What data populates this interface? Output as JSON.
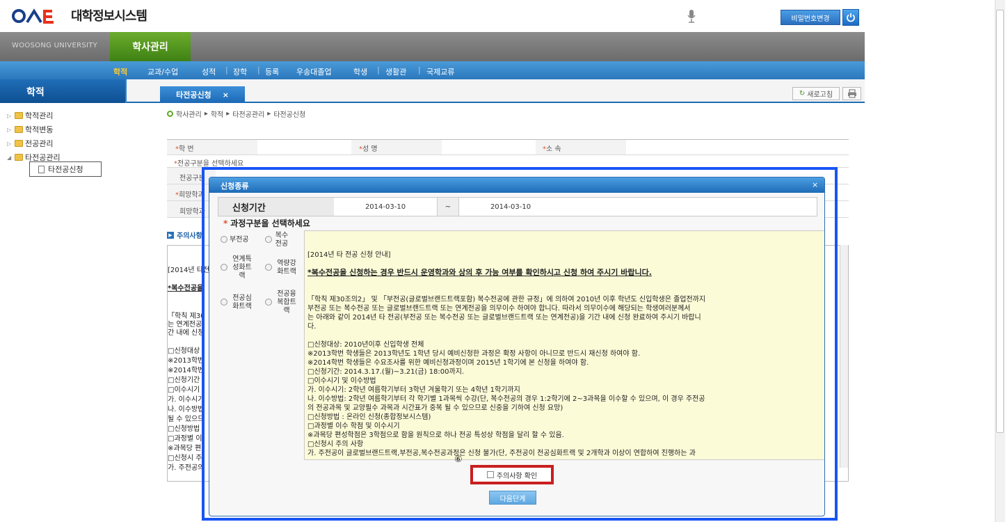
{
  "header": {
    "system_title": "대학정보시스템",
    "password_button": "비밀번호변경"
  },
  "topbar": {
    "university": "WOOSONG UNIVERSITY",
    "main_tab": "학사관리"
  },
  "menu": {
    "items": [
      "학적",
      "교과/수업",
      "성적",
      "장학",
      "등록",
      "우송대졸업",
      "학생",
      "생활관",
      "국제교류"
    ],
    "active_index": 0
  },
  "sidebar": {
    "title": "학적",
    "tree": [
      {
        "label": "학적관리"
      },
      {
        "label": "학적변동"
      },
      {
        "label": "전공관리"
      },
      {
        "label": "타전공관리"
      }
    ],
    "selected_leaf": "타전공신청"
  },
  "content": {
    "tab_label": "타전공신청",
    "tab_close": "×",
    "refresh_label": "새로고침",
    "breadcrumb": [
      "학사관리",
      "학적",
      "타전공관리",
      "타전공신청"
    ],
    "form": {
      "student_no_label": "학 번",
      "name_label": "성 명",
      "affiliation_label": "소 속",
      "major_type_prompt": "전공구분을 선택하세요",
      "major_type_label": "전공구분",
      "desired_label": "희망학과",
      "desired2_label": "희망학과"
    },
    "notice_header": "주의사항",
    "under_notice_lines": [
      "[2014년 타전공",
      "*복수전공을",
      "「학칙 제30",
      "는 연계전공",
      "간 내에 신청",
      "□신청대상",
      "※2013학번",
      "※2014학번",
      "□신청기간",
      "□이수시기",
      "가. 이수시기",
      "나. 이수방법",
      "될 수 있으므",
      "□신청방법",
      "□과정별 이",
      "※과목당 편",
      "□신청시 주",
      "가. 주전공의"
    ]
  },
  "modal": {
    "title": "신청종류",
    "close": "×",
    "period_label": "신청기간",
    "start_date": "2014-03-10",
    "tilde": "~",
    "end_date": "2014-03-10",
    "section_title": "과정구분을 선택하세요",
    "options": [
      "부전공",
      "복수전공",
      "연계특성화트랙",
      "역량강화트랙",
      "전공심화트랙",
      "전공융복합트랙"
    ],
    "notice_lines": [
      "[2014년 타 전공 신청 안내]",
      "*복수전공을 신청하는 경우 반드시 운영학과와 상의 후 가능 여부를 확인하시고 신청 하여 주시기 바랍니다.",
      "「학칙 제30조의2」 및 「부전공(글로벌브랜드트랙포함) 복수전공에 관한 규정」에 의하여 2010년 이후 학년도 신입학생은 졸업전까지",
      "부전공 또는 복수전공 또는 글로벌브랜드트랙 또는 연계전공을 의무이수 하여야 합니다. 따라서 의무이수에 해당되는 학생여러분께서",
      "는 아래와 같이 2014년 타 전공(부전공 또는 복수전공 또는 글로벌브랜드트랙 또는 연계전공)을 기간 내에 신청 완료하여 주시기 바랍니",
      "다.",
      "□신청대상: 2010년이후 신입학생 전체",
      "※2013학번 학생들은 2013학년도 1학년 당시 예비신청한 과정은 확정 사항이 아니므로 반드시 재신청 하여야 함.",
      "※2014학번 학생들은 수요조사를 위한 예비신청과정이며 2015년 1학기에 본 신청을 하여야 함.",
      "□신청기간: 2014.3.17.(월)~3.21(금) 18:00까지.",
      "□이수시기 및 이수방법",
      "가. 이수시기: 2학년 여름학기부터 3학년 겨울학기 또는 4학년 1학기까지",
      "나. 이수방법: 2학년 여름학기부터 각 학기별 1과목씩 수강(단, 복수전공의 경우 1:2학기에 2~3과목을 이수할 수 있으며, 이 경우 주전공",
      "의 전공과목 및 교양필수 과목과 시간표가 중복 될 수 있으므로 신중을 기하여 신청 요망)",
      "□신청방법 : 온라인 신청(종합정보시스템)",
      "□과정별 이수 학점 및 이수시기",
      "※과목당 편성학점은 3학점으로 함을 원칙으로 하나 전공 특성상 학점을 달리 할 수 있음.",
      "□신청시 주의 사항",
      "가. 주전공이 글로벌브랜드트랙,부전공,복수전공과정은 신청 불가(단, 주전공이 전공심화트랙 및 2개학과 이상이 연합하여 진행하는 과"
    ],
    "step_number": "⑥",
    "confirm_label": "주의사항 확인",
    "next_button": "다음단계"
  },
  "colors": {
    "accent_blue": "#1e6bb7",
    "green_tab": "#4e8f1c",
    "highlight_blue": "#1855f5",
    "highlight_red": "#c81f1f",
    "notice_bg": "#fbfbd8"
  }
}
